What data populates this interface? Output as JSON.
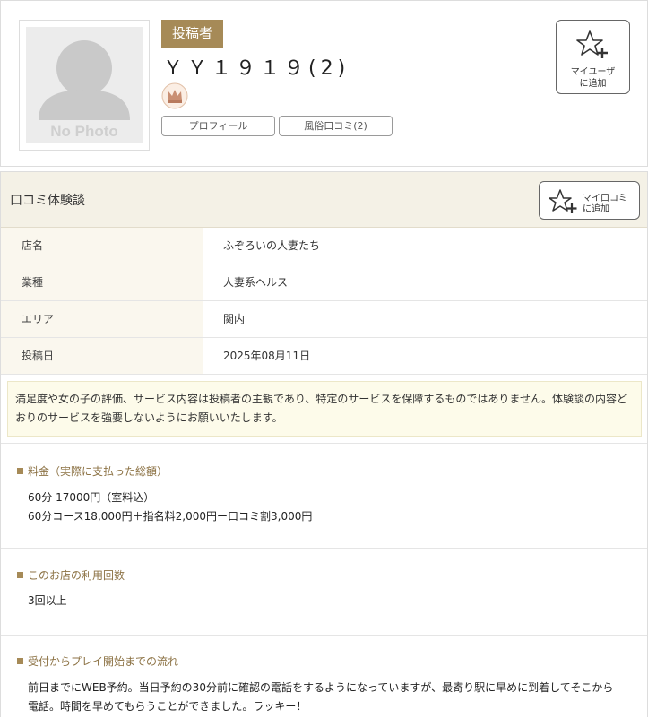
{
  "profile": {
    "role_badge": "投稿者",
    "user_name": "ＹＹ１９１９(2)",
    "avatar_text": "No Photo",
    "buttons": {
      "profile": "プロフィール",
      "reviews": "風俗口コミ(2)"
    },
    "add_myuser": {
      "line1": "マイユーザ",
      "line2": "に追加"
    }
  },
  "review": {
    "title": "口コミ体験談",
    "add_mycomi": {
      "line1": "マイ口コミ",
      "line2": "に追加"
    },
    "info": [
      {
        "label": "店名",
        "value": "ふぞろいの人妻たち"
      },
      {
        "label": "業種",
        "value": "人妻系ヘルス"
      },
      {
        "label": "エリア",
        "value": "関内"
      },
      {
        "label": "投稿日",
        "value": "2025年08月11日"
      }
    ],
    "notice": "満足度や女の子の評価、サービス内容は投稿者の主観であり、特定のサービスを保障するものではありません。体験談の内容どおりのサービスを強要しないようにお願いいたします。",
    "sections": [
      {
        "heading": "料金（実際に支払った総額）",
        "lines": [
          "60分 17000円（室料込）",
          "60分コース18,000円＋指名料2,000円ー口コミ割3,000円"
        ]
      },
      {
        "heading": "このお店の利用回数",
        "lines": [
          "3回以上"
        ]
      },
      {
        "heading": "受付からプレイ開始までの流れ",
        "lines": [
          "前日までにWEB予約。当日予約の30分前に確認の電話をするようになっていますが、最寄り駅に早めに到着してそこから電話。時間を早めてもらうことができました。ラッキー！"
        ]
      }
    ]
  },
  "colors": {
    "accent": "#a68a57",
    "header_bg": "#f4f1e6",
    "label_bg": "#faf7ee",
    "notice_bg": "#fdfbea"
  },
  "icons": [
    "avatar-placeholder",
    "crown-rank-icon",
    "star-plus-icon"
  ]
}
